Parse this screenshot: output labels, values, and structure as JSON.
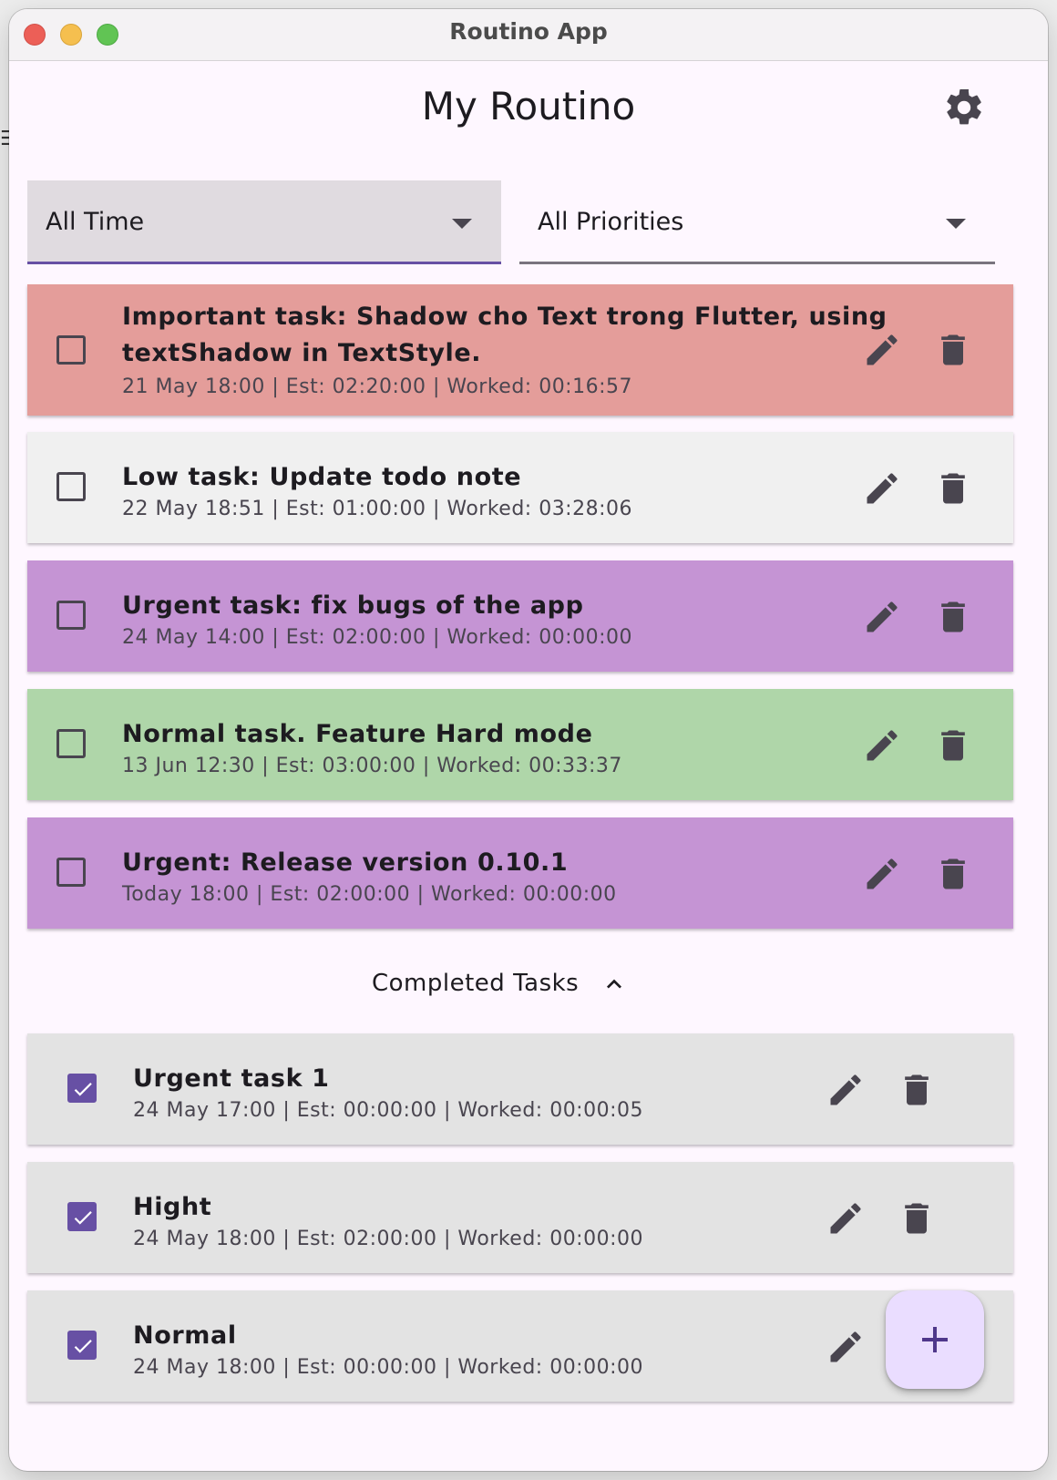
{
  "window": {
    "title": "Routino App"
  },
  "header": {
    "title": "My Routino",
    "settings_icon": "gear-icon"
  },
  "filters": {
    "time": {
      "selected": "All Time"
    },
    "priority": {
      "selected": "All Priorities"
    }
  },
  "tasks": [
    {
      "title_line1": "Important task: Shadow cho Text trong Flutter, using",
      "title_line2": "textShadow in TextStyle.",
      "meta": "21 May 18:00 | Est: 02:20:00 | Worked: 00:16:57",
      "color": "#e49d9a"
    },
    {
      "title_line1": "Low task: Update todo note",
      "meta": "22 May 18:51 | Est: 01:00:00 | Worked: 03:28:06",
      "color": "#f0f0f0"
    },
    {
      "title_line1": "Urgent task: fix bugs of the app",
      "meta": "24 May 14:00 | Est: 02:00:00 | Worked: 00:00:00",
      "color": "#c594d4"
    },
    {
      "title_line1": "Normal task. Feature Hard mode",
      "meta": "13 Jun 12:30 | Est: 03:00:00 | Worked: 00:33:37",
      "color": "#afd6a9"
    },
    {
      "title_line1": "Urgent: Release version 0.10.1",
      "meta": "Today 18:00 | Est: 02:00:00 | Worked: 00:00:00",
      "color": "#c594d4"
    }
  ],
  "completed": {
    "label": "Completed Tasks",
    "tasks": [
      {
        "title": "Urgent task 1",
        "meta": "24 May 17:00 | Est: 00:00:00 | Worked: 00:00:05"
      },
      {
        "title": "Hight",
        "meta": "24 May 18:00 | Est: 02:00:00 | Worked: 00:00:00"
      },
      {
        "title": "Normal",
        "meta": "24 May 18:00 | Est: 00:00:00 | Worked: 00:00:00"
      }
    ]
  },
  "fab": {
    "icon": "plus-icon"
  },
  "colors": {
    "accent": "#6750a4",
    "fab_bg": "#eaddff",
    "completed_bg": "#e3e3e3"
  }
}
